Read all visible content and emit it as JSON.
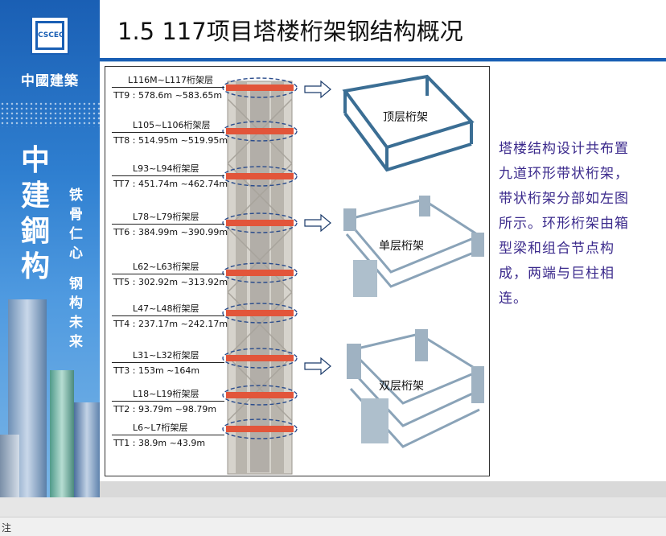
{
  "sidebar": {
    "logo_text": "CSCEC",
    "brand": "中國建築",
    "big_chars": [
      "中",
      "建",
      "鋼",
      "构"
    ],
    "motto": [
      "铁",
      "骨",
      "仁",
      "心",
      "钢",
      "构",
      "未",
      "来"
    ]
  },
  "title": "1.5 117项目塔楼桁架钢结构概况",
  "description": "塔楼结构设计共布置九道环形带状桁架，带状桁架分部如左图所示。环形桁架由箱型梁和组合节点构成，两端与巨柱相连。",
  "levels": [
    {
      "floors": "L116M~L117桁架层",
      "elev": "TT9 : 578.6m ~583.65m"
    },
    {
      "floors": "L105~L106桁架层",
      "elev": "TT8 : 514.95m ~519.95m"
    },
    {
      "floors": "L93~L94桁架层",
      "elev": "TT7 : 451.74m ~462.74m"
    },
    {
      "floors": "L78~L79桁架层",
      "elev": "TT6 : 384.99m ~390.99m"
    },
    {
      "floors": "L62~L63桁架层",
      "elev": "TT5 : 302.92m ~313.92m"
    },
    {
      "floors": "L47~L48桁架层",
      "elev": "TT4 : 237.17m ~242.17m"
    },
    {
      "floors": "L31~L32桁架层",
      "elev": "TT3 : 153m ~164m"
    },
    {
      "floors": "L18~L19桁架层",
      "elev": "TT2 : 93.79m ~98.79m"
    },
    {
      "floors": "L6~L7桁架层",
      "elev": "TT1 : 38.9m ~43.9m"
    }
  ],
  "truss_types": [
    {
      "label": "顶层桁架"
    },
    {
      "label": "单层桁架"
    },
    {
      "label": "双层桁架"
    }
  ],
  "notes_label": "注",
  "colors": {
    "accent": "#1a5fb4",
    "truss_red": "#e2553a",
    "desc_text": "#3b2a8c"
  }
}
